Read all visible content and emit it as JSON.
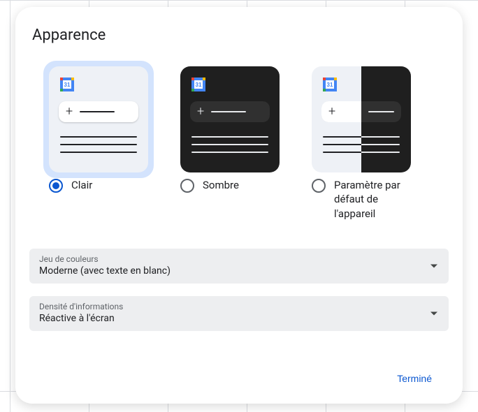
{
  "title": "Apparence",
  "themes": {
    "light": {
      "label": "Clair"
    },
    "dark": {
      "label": "Sombre"
    },
    "device": {
      "label": "Paramètre par défaut de l'appareil"
    }
  },
  "colorScheme": {
    "label": "Jeu de couleurs",
    "value": "Moderne (avec texte en blanc)"
  },
  "density": {
    "label": "Densité d'informations",
    "value": "Réactive à l'écran"
  },
  "doneLabel": "Terminé"
}
